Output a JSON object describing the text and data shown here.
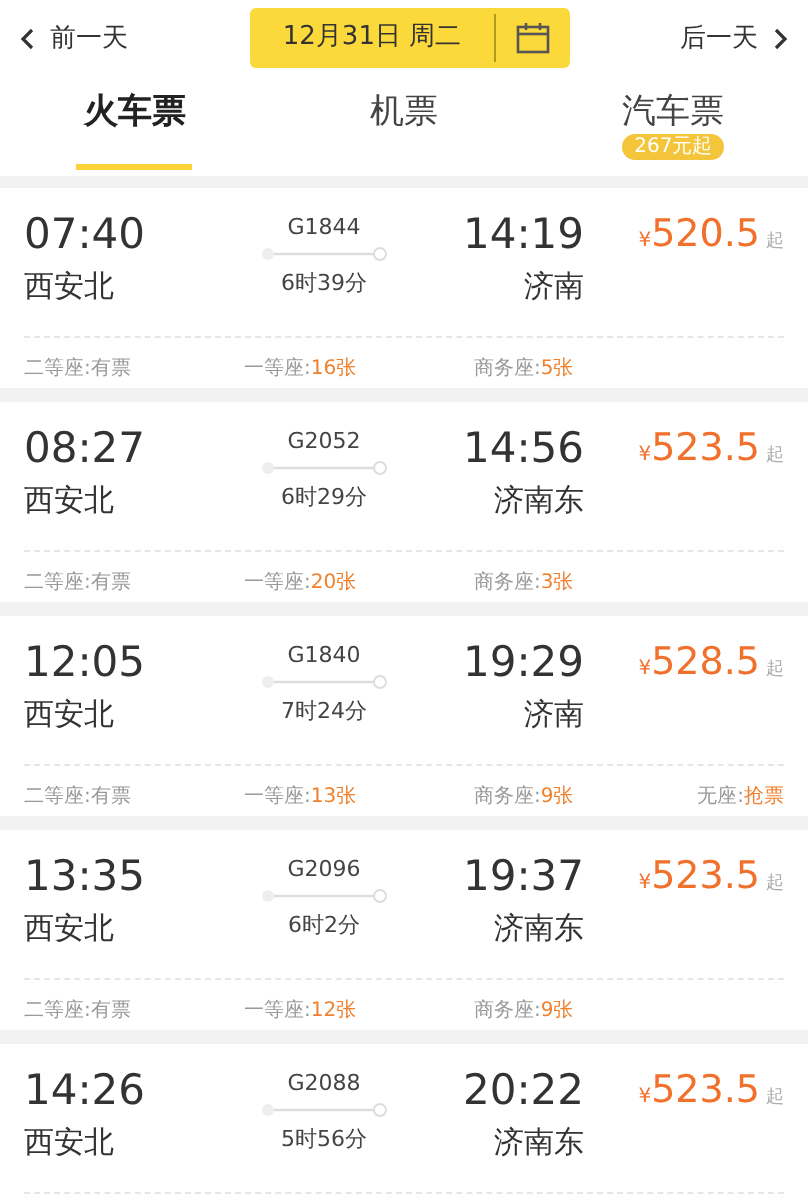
{
  "date_bar": {
    "prev": "前一天",
    "date": "12月31日 周二",
    "next": "后一天"
  },
  "tabs": [
    {
      "label": "火车票",
      "selected": true
    },
    {
      "label": "机票",
      "selected": false
    },
    {
      "label": "汽车票",
      "selected": false,
      "badge": "267元起"
    }
  ],
  "trains": [
    {
      "depart": "07:40",
      "from": "西安北",
      "number": "G1844",
      "duration": "6时39分",
      "arrive": "14:19",
      "to": "济南",
      "currency": "¥",
      "price": "520.5",
      "price_suffix": "起",
      "seats": [
        {
          "label": "二等座:",
          "value": "有票",
          "highlight": false
        },
        {
          "label": "一等座:",
          "value": "16张",
          "highlight": true
        },
        {
          "label": "商务座:",
          "value": "5张",
          "highlight": true
        }
      ]
    },
    {
      "depart": "08:27",
      "from": "西安北",
      "number": "G2052",
      "duration": "6时29分",
      "arrive": "14:56",
      "to": "济南东",
      "currency": "¥",
      "price": "523.5",
      "price_suffix": "起",
      "seats": [
        {
          "label": "二等座:",
          "value": "有票",
          "highlight": false
        },
        {
          "label": "一等座:",
          "value": "20张",
          "highlight": true
        },
        {
          "label": "商务座:",
          "value": "3张",
          "highlight": true
        }
      ]
    },
    {
      "depart": "12:05",
      "from": "西安北",
      "number": "G1840",
      "duration": "7时24分",
      "arrive": "19:29",
      "to": "济南",
      "currency": "¥",
      "price": "528.5",
      "price_suffix": "起",
      "seats": [
        {
          "label": "二等座:",
          "value": "有票",
          "highlight": false
        },
        {
          "label": "一等座:",
          "value": "13张",
          "highlight": true
        },
        {
          "label": "商务座:",
          "value": "9张",
          "highlight": true
        },
        {
          "label": "无座:",
          "value": "抢票",
          "highlight": true
        }
      ]
    },
    {
      "depart": "13:35",
      "from": "西安北",
      "number": "G2096",
      "duration": "6时2分",
      "arrive": "19:37",
      "to": "济南东",
      "currency": "¥",
      "price": "523.5",
      "price_suffix": "起",
      "seats": [
        {
          "label": "二等座:",
          "value": "有票",
          "highlight": false
        },
        {
          "label": "一等座:",
          "value": "12张",
          "highlight": true
        },
        {
          "label": "商务座:",
          "value": "9张",
          "highlight": true
        }
      ]
    },
    {
      "depart": "14:26",
      "from": "西安北",
      "number": "G2088",
      "duration": "5时56分",
      "arrive": "20:22",
      "to": "济南东",
      "currency": "¥",
      "price": "523.5",
      "price_suffix": "起"
    }
  ]
}
